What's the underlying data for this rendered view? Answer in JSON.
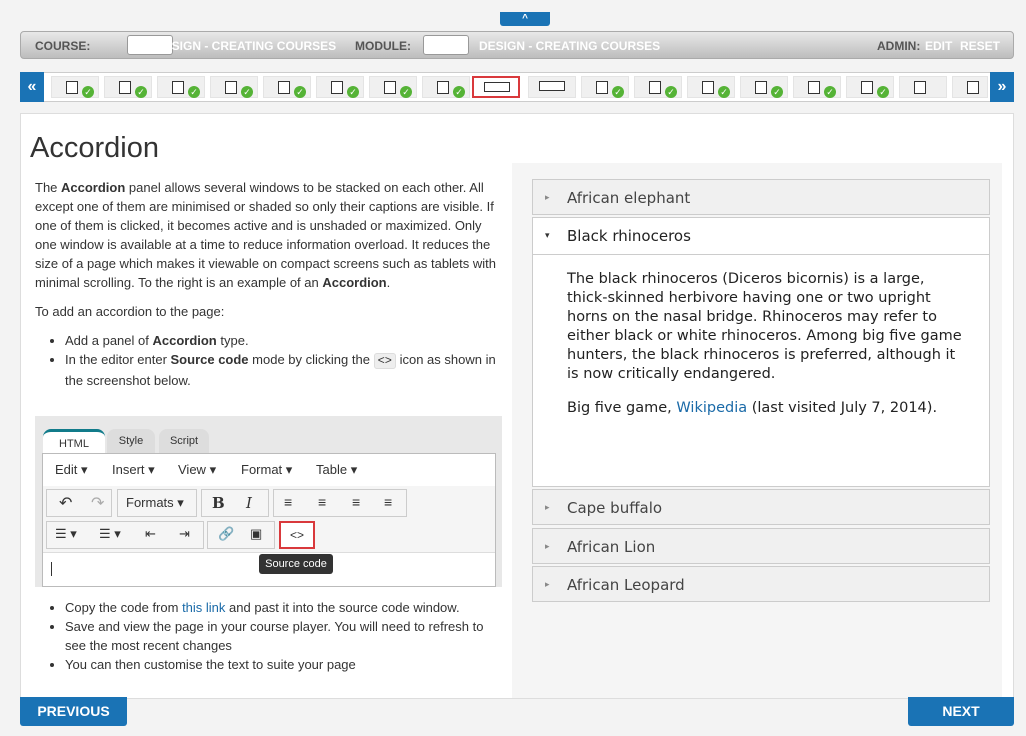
{
  "header": {
    "collapse_glyph": "^",
    "course_label": "COURSE:",
    "course_value": "DESIGN - CREATING COURSES",
    "module_label": "MODULE:",
    "module_value": "DESIGN - CREATING COURSES",
    "admin_label": "ADMIN:",
    "edit_link": "EDIT",
    "reset_link": "RESET"
  },
  "strip": {
    "prev_glyph": "«",
    "next_glyph": "»",
    "check_glyph": "✓"
  },
  "page": {
    "title": "Accordion",
    "intro_p1_a": "The ",
    "intro_p1_bold": "Accordion",
    "intro_p1_b": " panel allows several windows to be stacked on each other. All except one of them are minimised or shaded so only their captions are visible. If one of them is clicked, it becomes active and is unshaded or maximized. Only one window is available at a time to reduce information overload. It reduces the size of a page which makes it viewable on compact screens such as tablets with minimal scrolling. To the right is an example of an ",
    "intro_p1_bold2": "Accordion",
    "intro_p1_c": ".",
    "intro_p2": "To add an accordion to the page:",
    "step1_a": "Add a panel of ",
    "step1_bold": "Accordion",
    "step1_b": " type.",
    "step2_a": "In the editor enter ",
    "step2_bold": "Source code",
    "step2_b": " mode by clicking the ",
    "step2_code": "<>",
    "step2_c": " icon as shown in the screenshot below.",
    "step3_a": "Copy the code from ",
    "step3_link": "this link",
    "step3_b": " and past it into the source code window.",
    "step4": "Save and view the page in your course player. You will need to refresh to see the most recent changes",
    "step5": "You can then customise the text to suite your page"
  },
  "editor": {
    "tabs": [
      "HTML",
      "Style",
      "Script"
    ],
    "menus": [
      "Edit",
      "Insert",
      "View",
      "Format",
      "Table"
    ],
    "formats_label": "Formats",
    "bold_glyph": "B",
    "italic_glyph": "I",
    "source_glyph": "<>",
    "tooltip": "Source code"
  },
  "accordion": {
    "items": [
      {
        "title": "African elephant",
        "caret": "▸"
      },
      {
        "title": "Black rhinoceros",
        "caret": "▾",
        "body_p1": "The black rhinoceros (Diceros bicornis) is a large, thick-skinned herbivore having one or two upright horns on the nasal bridge. Rhinoceros may refer to either black or white rhinoceros. Among big five game hunters, the black rhinoceros is preferred, although it is now critically endangered.",
        "body_p2_a": "Big five game, ",
        "body_p2_link": "Wikipedia",
        "body_p2_b": " (last visited July 7, 2014)."
      },
      {
        "title": "Cape buffalo",
        "caret": "▸"
      },
      {
        "title": "African Lion",
        "caret": "▸"
      },
      {
        "title": "African Leopard",
        "caret": "▸"
      }
    ]
  },
  "footer": {
    "previous_label": "PREVIOUS",
    "next_label": "NEXT"
  }
}
